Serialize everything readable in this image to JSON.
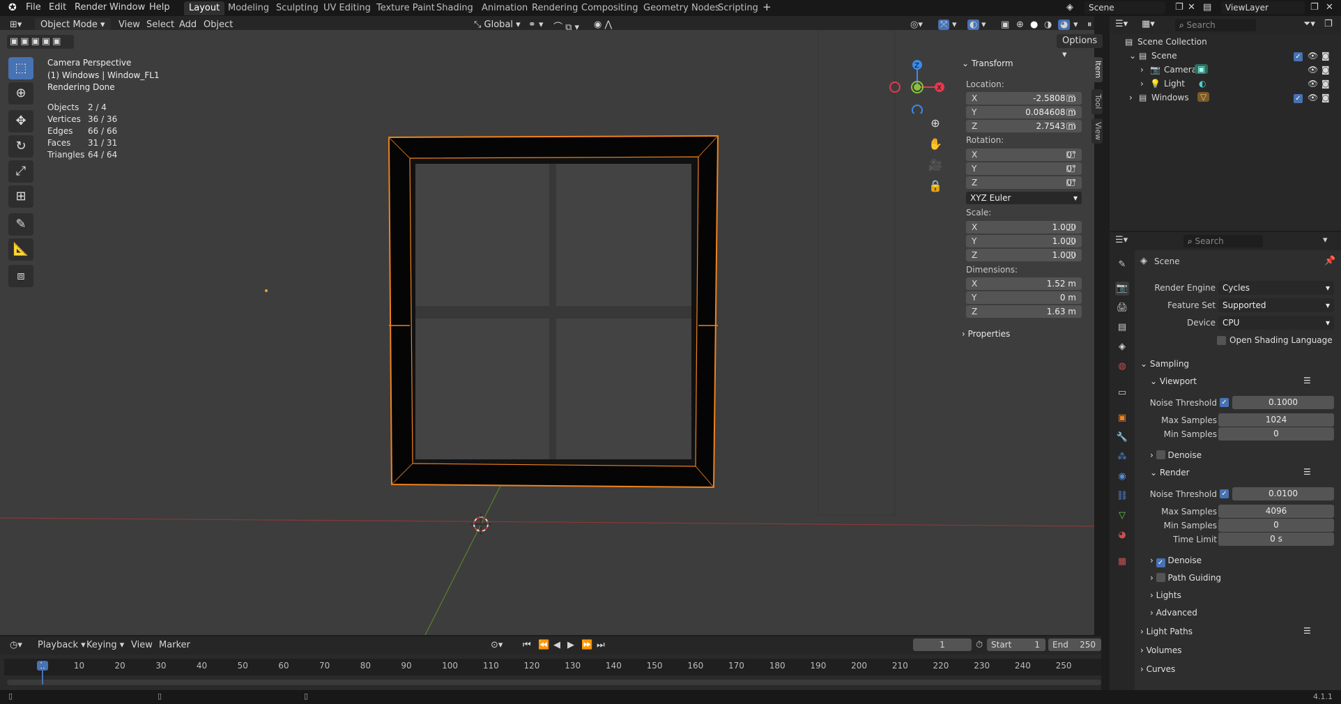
{
  "menu": {
    "file": "File",
    "edit": "Edit",
    "render": "Render",
    "window": "Window",
    "help": "Help"
  },
  "workspaces": [
    "Layout",
    "Modeling",
    "Sculpting",
    "UV Editing",
    "Texture Paint",
    "Shading",
    "Animation",
    "Rendering",
    "Compositing",
    "Geometry Nodes",
    "Scripting"
  ],
  "scene_name": "Scene",
  "view_layer": "ViewLayer",
  "viewport_header": {
    "mode": "Object Mode",
    "view": "View",
    "select": "Select",
    "add": "Add",
    "object": "Object",
    "orientation": "Global",
    "options": "Options"
  },
  "overlay": {
    "line1": "Camera Perspective",
    "line2": "(1) Windows | Window_FL1",
    "line3": "Rendering Done",
    "stats": [
      {
        "label": "Objects",
        "value": "2 / 4"
      },
      {
        "label": "Vertices",
        "value": "36 / 36"
      },
      {
        "label": "Edges",
        "value": "66 / 66"
      },
      {
        "label": "Faces",
        "value": "31 / 31"
      },
      {
        "label": "Triangles",
        "value": "64 / 64"
      }
    ]
  },
  "gizmo": {
    "x": "X",
    "y": "Y",
    "z": "Z"
  },
  "npanel": {
    "title": "Transform",
    "location_label": "Location:",
    "location": [
      {
        "axis": "X",
        "value": "-2.5808 m"
      },
      {
        "axis": "Y",
        "value": "0.084608 m"
      },
      {
        "axis": "Z",
        "value": "2.7543 m"
      }
    ],
    "rotation_label": "Rotation:",
    "rotation": [
      {
        "axis": "X",
        "value": "0°"
      },
      {
        "axis": "Y",
        "value": "0°"
      },
      {
        "axis": "Z",
        "value": "0°"
      }
    ],
    "rotation_mode": "XYZ Euler",
    "scale_label": "Scale:",
    "scale": [
      {
        "axis": "X",
        "value": "1.000"
      },
      {
        "axis": "Y",
        "value": "1.000"
      },
      {
        "axis": "Z",
        "value": "1.000"
      }
    ],
    "dimensions_label": "Dimensions:",
    "dimensions": [
      {
        "axis": "X",
        "value": "1.52 m"
      },
      {
        "axis": "Y",
        "value": "0 m"
      },
      {
        "axis": "Z",
        "value": "1.63 m"
      }
    ],
    "properties": "Properties",
    "tabs": {
      "item": "Item",
      "tool": "Tool",
      "view": "View"
    }
  },
  "outliner": {
    "search_placeholder": "Search",
    "collection": "Scene Collection",
    "rows": [
      "Scene",
      "Camera",
      "Light",
      "Windows"
    ]
  },
  "properties": {
    "search_placeholder": "Search",
    "scene": "Scene",
    "render_engine_label": "Render Engine",
    "render_engine": "Cycles",
    "feature_set_label": "Feature Set",
    "feature_set": "Supported",
    "device_label": "Device",
    "device": "CPU",
    "osl": "Open Shading Language",
    "sampling": "Sampling",
    "viewport": "Viewport",
    "vp_noise_label": "Noise Threshold",
    "vp_noise": "0.1000",
    "vp_max_label": "Max Samples",
    "vp_max": "1024",
    "vp_min_label": "Min Samples",
    "vp_min": "0",
    "vp_denoise": "Denoise",
    "render": "Render",
    "r_noise_label": "Noise Threshold",
    "r_noise": "0.0100",
    "r_max_label": "Max Samples",
    "r_max": "4096",
    "r_min_label": "Min Samples",
    "r_min": "0",
    "r_time_label": "Time Limit",
    "r_time": "0 s",
    "r_denoise": "Denoise",
    "path_guiding": "Path Guiding",
    "lights": "Lights",
    "advanced": "Advanced",
    "light_paths": "Light Paths",
    "volumes": "Volumes",
    "curves": "Curves"
  },
  "timeline": {
    "playback": "Playback",
    "keying": "Keying",
    "view": "View",
    "marker": "Marker",
    "current_frame": "1",
    "start_label": "Start",
    "start": "1",
    "end_label": "End",
    "end": "250",
    "ticks": [
      "1",
      "10",
      "20",
      "30",
      "40",
      "50",
      "60",
      "70",
      "80",
      "90",
      "100",
      "110",
      "120",
      "130",
      "140",
      "150",
      "160",
      "170",
      "180",
      "190",
      "200",
      "210",
      "220",
      "230",
      "240",
      "250"
    ]
  },
  "version": "4.1.1",
  "colors": {
    "accent": "#4772b3",
    "selection": "#f0821e",
    "x_axis": "#e8384e",
    "y_axis": "#8ac23c",
    "z_axis": "#3b8ce8"
  }
}
